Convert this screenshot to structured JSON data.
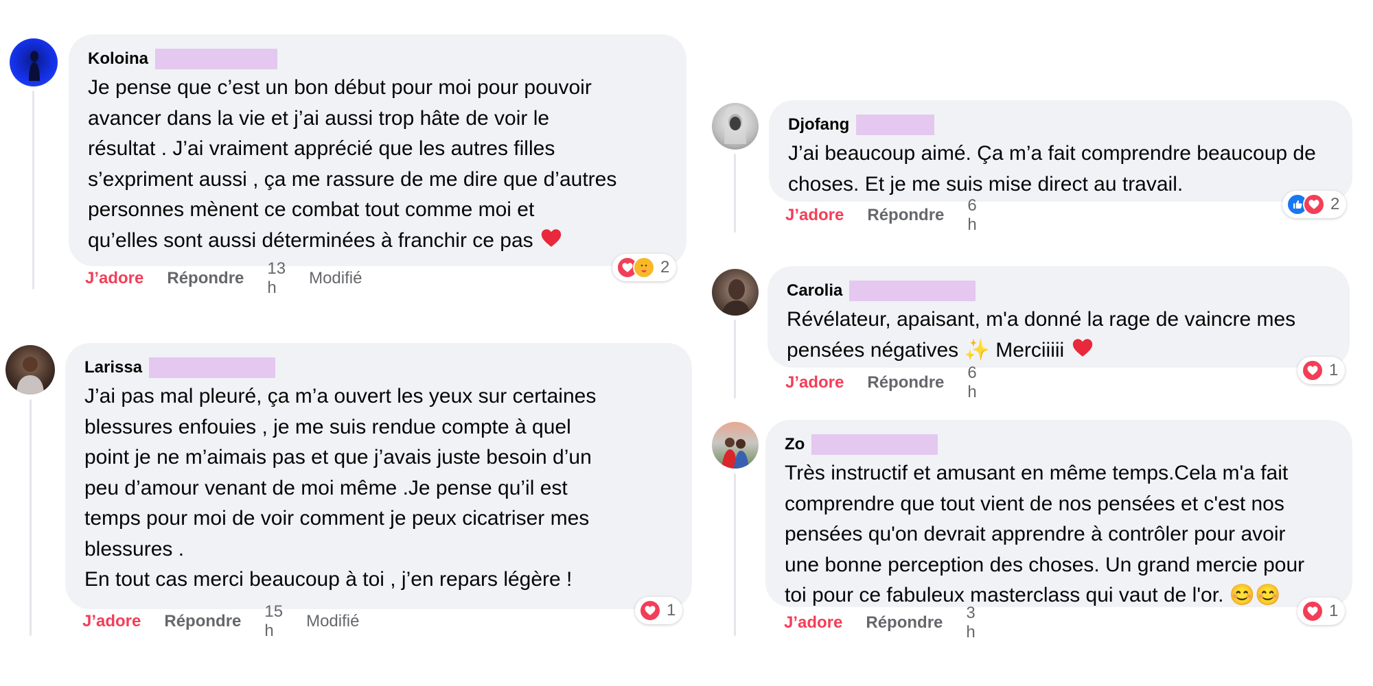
{
  "actions": {
    "love": "J’adore",
    "reply": "Répondre"
  },
  "comments": [
    {
      "author": "Koloina",
      "lines": [
        "Je pense que c’est un bon début pour moi pour pouvoir",
        "avancer dans la vie et j’ai aussi trop hâte de voir le",
        "résultat . J’ai vraiment apprécié que les autres filles",
        "s’expriment aussi , ça me rassure de me dire que d’autres",
        "personnes mènent ce combat tout comme moi et",
        "qu’elles sont aussi déterminées à franchir ce pas"
      ],
      "time": "13 h",
      "edited": "Modifié",
      "reaction_count": "2",
      "reaction_icons": [
        "heart-icon",
        "care-icon"
      ]
    },
    {
      "author": "Larissa",
      "lines": [
        "J’ai pas mal pleuré, ça m’a ouvert les yeux sur certaines",
        "blessures enfouies , je me suis rendue compte à quel",
        "point je ne m’aimais pas et que j’avais juste besoin d’un",
        "peu d’amour venant de moi même .Je pense qu’il est",
        "temps pour moi de voir comment je peux cicatriser mes",
        "blessures .",
        "En tout cas merci beaucoup à toi , j’en repars légère !"
      ],
      "time": "15 h",
      "edited": "Modifié",
      "reaction_count": "1",
      "reaction_icons": [
        "heart-icon"
      ]
    },
    {
      "author": "Djofang",
      "lines": [
        "J’ai beaucoup aimé. Ça m’a fait comprendre beaucoup de",
        "choses. Et je me suis mise direct au travail."
      ],
      "time": "6 h",
      "reaction_count": "2",
      "reaction_icons": [
        "like-icon",
        "heart-icon"
      ]
    },
    {
      "author": "Carolia",
      "lines": [
        "Révélateur, apaisant, m'a donné la rage de vaincre mes",
        "pensées négatives ✨ Merciiiii"
      ],
      "time": "6 h",
      "reaction_count": "1",
      "reaction_icons": [
        "heart-icon"
      ]
    },
    {
      "author": "Zo",
      "lines": [
        "Très instructif et amusant en même temps.Cela m'a fait",
        "comprendre que tout vient de nos pensées et c'est nos",
        "pensées qu'on devrait apprendre à contrôler pour avoir",
        "une bonne perception des choses. Un grand mercie pour",
        "toi pour ce fabuleux masterclass qui vaut de l'or. 😊😊"
      ],
      "time": "3 h",
      "reaction_count": "1",
      "reaction_icons": [
        "heart-icon"
      ]
    }
  ]
}
